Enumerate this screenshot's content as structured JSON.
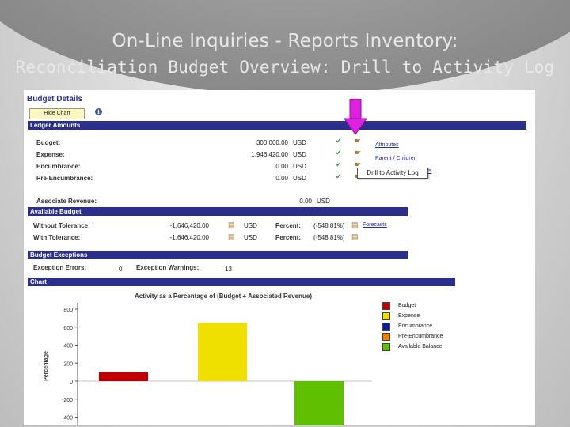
{
  "slide": {
    "title_line1": "On-Line Inquiries - Reports Inventory:",
    "title_line2": "Reconciliation Budget Overview: Drill to Activity Log"
  },
  "budget_details": {
    "title": "Budget Details",
    "hide_chart_label": "Hide Chart",
    "info_icon": "i"
  },
  "ledger": {
    "header": "Ledger Amounts",
    "rows": [
      {
        "label": "Budget:",
        "value": "300,000.00",
        "currency": "USD"
      },
      {
        "label": "Expense:",
        "value": "1,946,420.00",
        "currency": "USD"
      },
      {
        "label": "Encumbrance:",
        "value": "0.00",
        "currency": "USD"
      },
      {
        "label": "Pre-Encumbrance:",
        "value": "0.00",
        "currency": "USD"
      }
    ],
    "associate": {
      "label": "Associate Revenue:",
      "value": "0.00",
      "currency": "USD"
    },
    "links": {
      "attributes": "Attributes",
      "parent_children": "Parent / Children",
      "partial": "ts"
    },
    "tooltip": "Drill to Activity Log"
  },
  "available": {
    "header": "Available Budget",
    "rows": [
      {
        "label": "Without Tolerance:",
        "value": "-1,646,420.00",
        "currency": "USD",
        "percent_label": "Percent:",
        "percent": "(-548.81%)"
      },
      {
        "label": "With Tolerance:",
        "value": "-1,646,420.00",
        "currency": "USD",
        "percent_label": "Percent:",
        "percent": "(-548.81%)"
      }
    ],
    "forecasts": "Forecasts"
  },
  "exceptions": {
    "header": "Budget Exceptions",
    "errors_label": "Exception Errors:",
    "errors_value": "0",
    "warnings_label": "Exception Warnings:",
    "warnings_value": "13"
  },
  "chart_section": {
    "header": "Chart"
  },
  "chart_data": {
    "type": "bar",
    "title": "Activity as a Percentage of (Budget + Associated Revenue)",
    "ylabel": "Percentage",
    "xlabel": "",
    "categories": [
      "Budget",
      "Expense",
      "Encumbrance",
      "Pre-Encumbrance",
      "Available Balance"
    ],
    "values": [
      100,
      649,
      0,
      0,
      -549
    ],
    "colors": [
      "#c00000",
      "#f0e000",
      "#0a1ea0",
      "#f08000",
      "#60c000"
    ],
    "ylim": [
      -500,
      900
    ],
    "yticks": [
      "800",
      "600",
      "400",
      "200",
      "0",
      "-200",
      "-400"
    ],
    "legend": [
      "Budget",
      "Expense",
      "Encumbrance",
      "Pre-Encumbrance",
      "Available Balance"
    ],
    "legend_position": "right",
    "grid": false
  }
}
